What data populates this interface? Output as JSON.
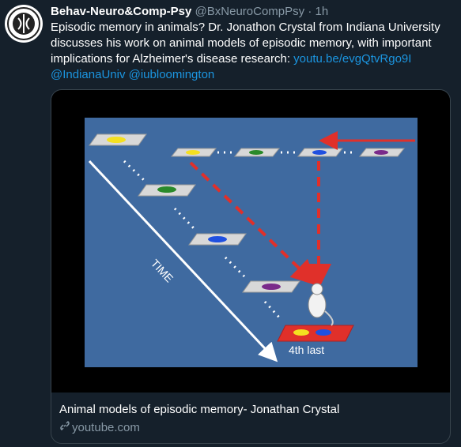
{
  "tweet": {
    "author_name": "Behav-Neuro&Comp-Psy",
    "handle": "@BxNeuroCompPsy",
    "separator": "·",
    "time": "1h",
    "text_plain": "Episodic memory in animals? Dr. Jonathon Crystal from Indiana University discusses his work on animal models of episodic memory, with important implications for Alzheimer's disease research: ",
    "link_url": "youtu.be/evgQtvRgo9I",
    "mention_1": "@IndianaUniv",
    "mention_2": "@iubloomington"
  },
  "card": {
    "title": "Animal models of episodic memory- Jonathan Crystal",
    "domain": "youtube.com",
    "slide": {
      "axis_label": "TIME",
      "target_label": "4th last"
    }
  },
  "colors": {
    "background": "#15202b",
    "link": "#1b95e0",
    "muted": "#8899a6",
    "slide_bg": "#3f6aa0",
    "arrow_red": "#e0302a"
  },
  "icons": [
    "avatar-logo",
    "link-chain-icon"
  ]
}
